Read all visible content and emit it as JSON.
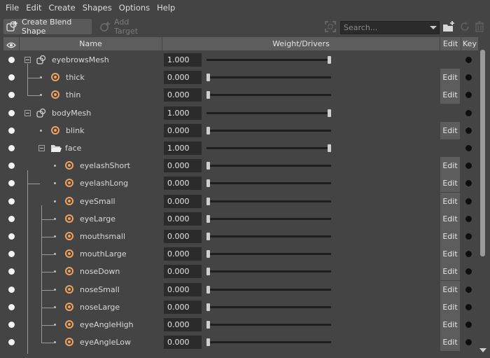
{
  "menu": [
    "File",
    "Edit",
    "Create",
    "Shapes",
    "Options",
    "Help"
  ],
  "toolbar": {
    "create_label": "Create Blend Shape",
    "add_target_label": "Add Target",
    "search_placeholder": "Search..."
  },
  "header": {
    "name": "Name",
    "weight": "Weight/Drivers",
    "edit": "Edit",
    "key": "Key"
  },
  "rows": [
    {
      "name": "eyebrowsMesh",
      "kind": "mesh",
      "weight": "1.000",
      "level": 1.0,
      "edit": null
    },
    {
      "name": "thick",
      "kind": "target",
      "weight": "0.000",
      "level": 0.0,
      "edit": "Edit"
    },
    {
      "name": "thin",
      "kind": "target",
      "weight": "0.000",
      "level": 0.0,
      "edit": "Edit"
    },
    {
      "name": "bodyMesh",
      "kind": "mesh",
      "weight": "1.000",
      "level": 1.0,
      "edit": null
    },
    {
      "name": "blink",
      "kind": "target",
      "weight": "0.000",
      "level": 0.0,
      "edit": "Edit"
    },
    {
      "name": "face",
      "kind": "group",
      "weight": "1.000",
      "level": 1.0,
      "edit": null
    },
    {
      "name": "eyelashShort",
      "kind": "target",
      "weight": "0.000",
      "level": 0.0,
      "edit": "Edit"
    },
    {
      "name": "eyelashLong",
      "kind": "target",
      "weight": "0.000",
      "level": 0.0,
      "edit": "Edit"
    },
    {
      "name": "eyeSmall",
      "kind": "target",
      "weight": "0.000",
      "level": 0.0,
      "edit": "Edit"
    },
    {
      "name": "eyeLarge",
      "kind": "target",
      "weight": "0.000",
      "level": 0.0,
      "edit": "Edit"
    },
    {
      "name": "mouthsmall",
      "kind": "target",
      "weight": "0.000",
      "level": 0.0,
      "edit": "Edit"
    },
    {
      "name": "mouthLarge",
      "kind": "target",
      "weight": "0.000",
      "level": 0.0,
      "edit": "Edit"
    },
    {
      "name": "noseDown",
      "kind": "target",
      "weight": "0.000",
      "level": 0.0,
      "edit": "Edit"
    },
    {
      "name": "noseSmall",
      "kind": "target",
      "weight": "0.000",
      "level": 0.0,
      "edit": "Edit"
    },
    {
      "name": "noseLarge",
      "kind": "target",
      "weight": "0.000",
      "level": 0.0,
      "edit": "Edit"
    },
    {
      "name": "eyeAngleHigh",
      "kind": "target",
      "weight": "0.000",
      "level": 0.0,
      "edit": "Edit"
    },
    {
      "name": "eyeAngleLow",
      "kind": "target",
      "weight": "0.000",
      "level": 0.0,
      "edit": "Edit"
    }
  ],
  "colors": {
    "background": "#444444",
    "header": "#5d5d5d",
    "target_icon": "#f0a35e",
    "field": "#2b2b2b"
  }
}
